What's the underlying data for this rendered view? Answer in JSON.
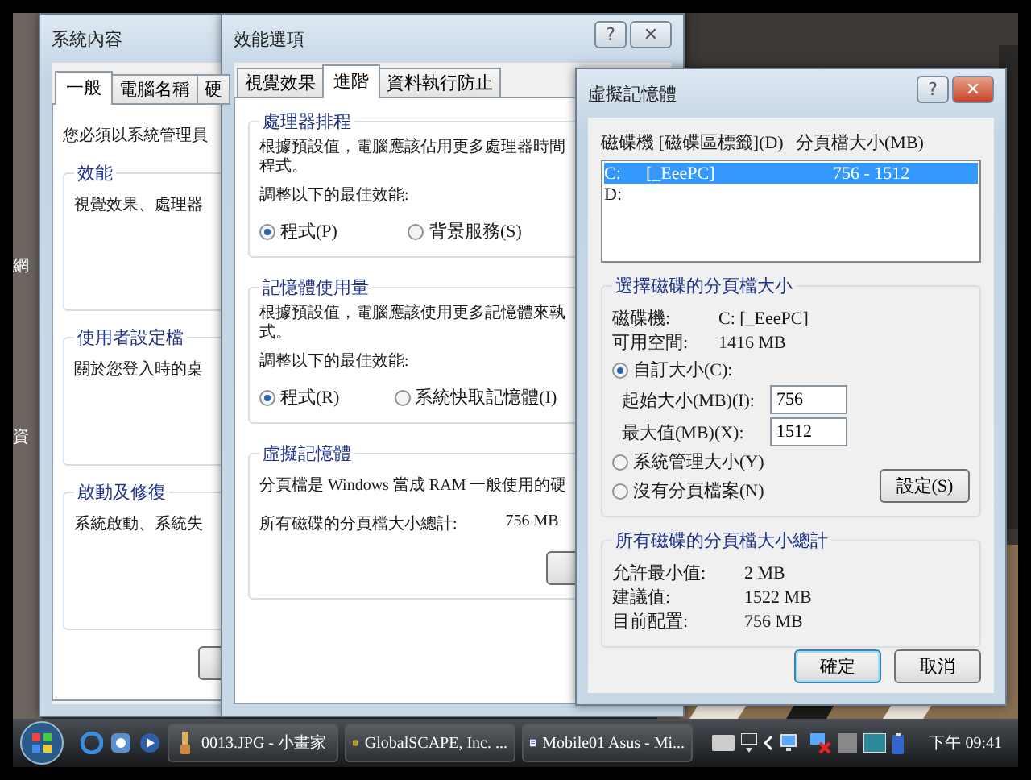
{
  "desktop": {
    "icon_labels": [
      "網",
      "資"
    ]
  },
  "system_properties": {
    "title": "系統內容",
    "tabs": [
      {
        "label": "一般",
        "selected": true
      },
      {
        "label": "電腦名稱",
        "selected": false
      },
      {
        "label": "硬",
        "selected": false
      }
    ],
    "note": "您必須以系統管理員",
    "groups": [
      {
        "title": "效能",
        "text": "視覺效果、處理器"
      },
      {
        "title": "使用者設定檔",
        "text": "關於您登入時的桌"
      },
      {
        "title": "啟動及修復",
        "text": "系統啟動、系統失"
      }
    ]
  },
  "performance_options": {
    "title": "效能選項",
    "title_buttons": [
      "?",
      "✕"
    ],
    "tabs": [
      {
        "label": "視覺效果",
        "selected": false
      },
      {
        "label": "進階",
        "selected": true
      },
      {
        "label": "資料執行防止",
        "selected": false
      }
    ],
    "radio_groups": [
      {
        "title": "處理器排程",
        "lines": [
          "根據預設值，電腦應該佔用更多處理器時間",
          "程式。"
        ],
        "prompt": "調整以下的最佳效能:",
        "options": [
          {
            "label": "程式(P)",
            "selected": true
          },
          {
            "label": "背景服務(S)",
            "selected": false
          }
        ]
      },
      {
        "title": "記憶體使用量",
        "lines": [
          "根據預設值，電腦應該使用更多記憶體來執",
          "式。"
        ],
        "prompt": "調整以下的最佳效能:",
        "options": [
          {
            "label": "程式(R)",
            "selected": true
          },
          {
            "label": "系統快取記憶體(I)",
            "selected": false
          }
        ]
      }
    ],
    "virtual_memory": {
      "title": "虛擬記憶體",
      "text": "分頁檔是 Windows 當成 RAM 一般使用的硬",
      "total_label": "所有磁碟的分頁檔大小總計:",
      "total_value": "756 MB"
    }
  },
  "virtual_memory_dialog": {
    "title": "虛擬記憶體",
    "title_buttons": [
      "?",
      "✕"
    ],
    "columns": [
      "磁碟機 [磁碟區標籤](D)",
      "分頁檔大小(MB)"
    ],
    "drives": [
      {
        "drive": "C:",
        "label": "[_EeePC]",
        "size": "756 - 1512",
        "selected": true
      },
      {
        "drive": "D:",
        "selected": false
      }
    ],
    "selected_group": {
      "title": "選擇磁碟的分頁檔大小",
      "info": [
        {
          "label": "磁碟機:",
          "value": "C:  [_EeePC]"
        },
        {
          "label": "可用空間:",
          "value": "1416 MB"
        }
      ],
      "custom": {
        "label": "自訂大小(C):",
        "selected": true
      },
      "fields": [
        {
          "label": "起始大小(MB)(I):",
          "value": "756"
        },
        {
          "label": "最大值(MB)(X):",
          "value": "1512"
        }
      ],
      "options": [
        {
          "label": "系統管理大小(Y)",
          "selected": false
        },
        {
          "label": "沒有分頁檔案(N)",
          "selected": false
        }
      ],
      "set_button": "設定(S)"
    },
    "totals_group": {
      "title": "所有磁碟的分頁檔大小總計",
      "rows": [
        {
          "label": "允許最小值:",
          "value": "2 MB"
        },
        {
          "label": "建議值:",
          "value": "1522 MB"
        },
        {
          "label": "目前配置:",
          "value": "756 MB"
        }
      ]
    },
    "buttons": [
      "確定",
      "取消"
    ]
  },
  "taskbar": {
    "tasks": [
      {
        "label": "0013.JPG - 小畫家",
        "kind": "paint"
      },
      {
        "label": "GlobalSCAPE, Inc. ...",
        "kind": "ftp"
      },
      {
        "label": "Mobile01 Asus - Mi...",
        "kind": "doc"
      }
    ],
    "clock": "下午 09:41"
  }
}
